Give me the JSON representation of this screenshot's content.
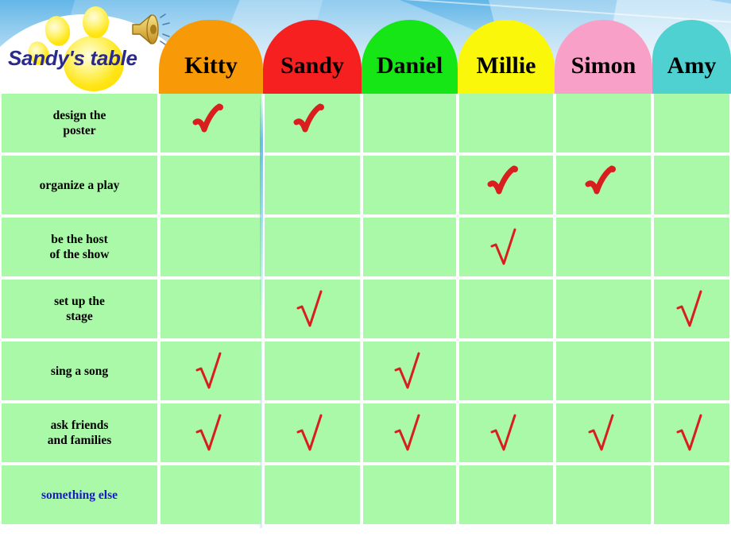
{
  "slide": {
    "title": "Sandy's table",
    "title_color": "#2A2A8C",
    "background_color": "#E8F3FB",
    "cell_color": "#AAF9A8",
    "check_color": "#D81E1E",
    "decorations": {
      "paw_print": "paw-print-decoration",
      "speaker": "speaker-icon",
      "cloud": "cloud-shape"
    }
  },
  "table": {
    "corner_label": "Sandy's table",
    "columns": [
      {
        "name": "Kitty",
        "color": "#F89A08"
      },
      {
        "name": "Sandy",
        "color": "#F72020"
      },
      {
        "name": "Daniel",
        "color": "#16E616"
      },
      {
        "name": "Millie",
        "color": "#FAF70A"
      },
      {
        "name": "Simon",
        "color": "#F9A0C8"
      },
      {
        "name": "Amy",
        "color": "#4FD1D1"
      }
    ],
    "rows": [
      {
        "label": "design the\nposter",
        "label_color": "#000000",
        "checks": [
          true,
          true,
          false,
          false,
          false,
          false
        ],
        "style": "thick"
      },
      {
        "label": "organize a play",
        "label_color": "#000000",
        "checks": [
          false,
          false,
          false,
          true,
          true,
          false
        ],
        "style": "thick"
      },
      {
        "label": "be the host\nof the show",
        "label_color": "#000000",
        "checks": [
          false,
          false,
          false,
          true,
          false,
          false
        ],
        "style": "thin"
      },
      {
        "label": "set up the\nstage",
        "label_color": "#000000",
        "checks": [
          false,
          true,
          false,
          false,
          false,
          true
        ],
        "style": "thin"
      },
      {
        "label": "sing a song",
        "label_color": "#000000",
        "checks": [
          true,
          false,
          true,
          false,
          false,
          false
        ],
        "style": "thin"
      },
      {
        "label": "ask friends\nand families",
        "label_color": "#000000",
        "checks": [
          true,
          true,
          true,
          true,
          true,
          true
        ],
        "style": "thin"
      },
      {
        "label": "something else",
        "label_color": "#1A1ACC",
        "checks": [
          false,
          false,
          false,
          false,
          false,
          false
        ],
        "style": "thin"
      }
    ]
  }
}
